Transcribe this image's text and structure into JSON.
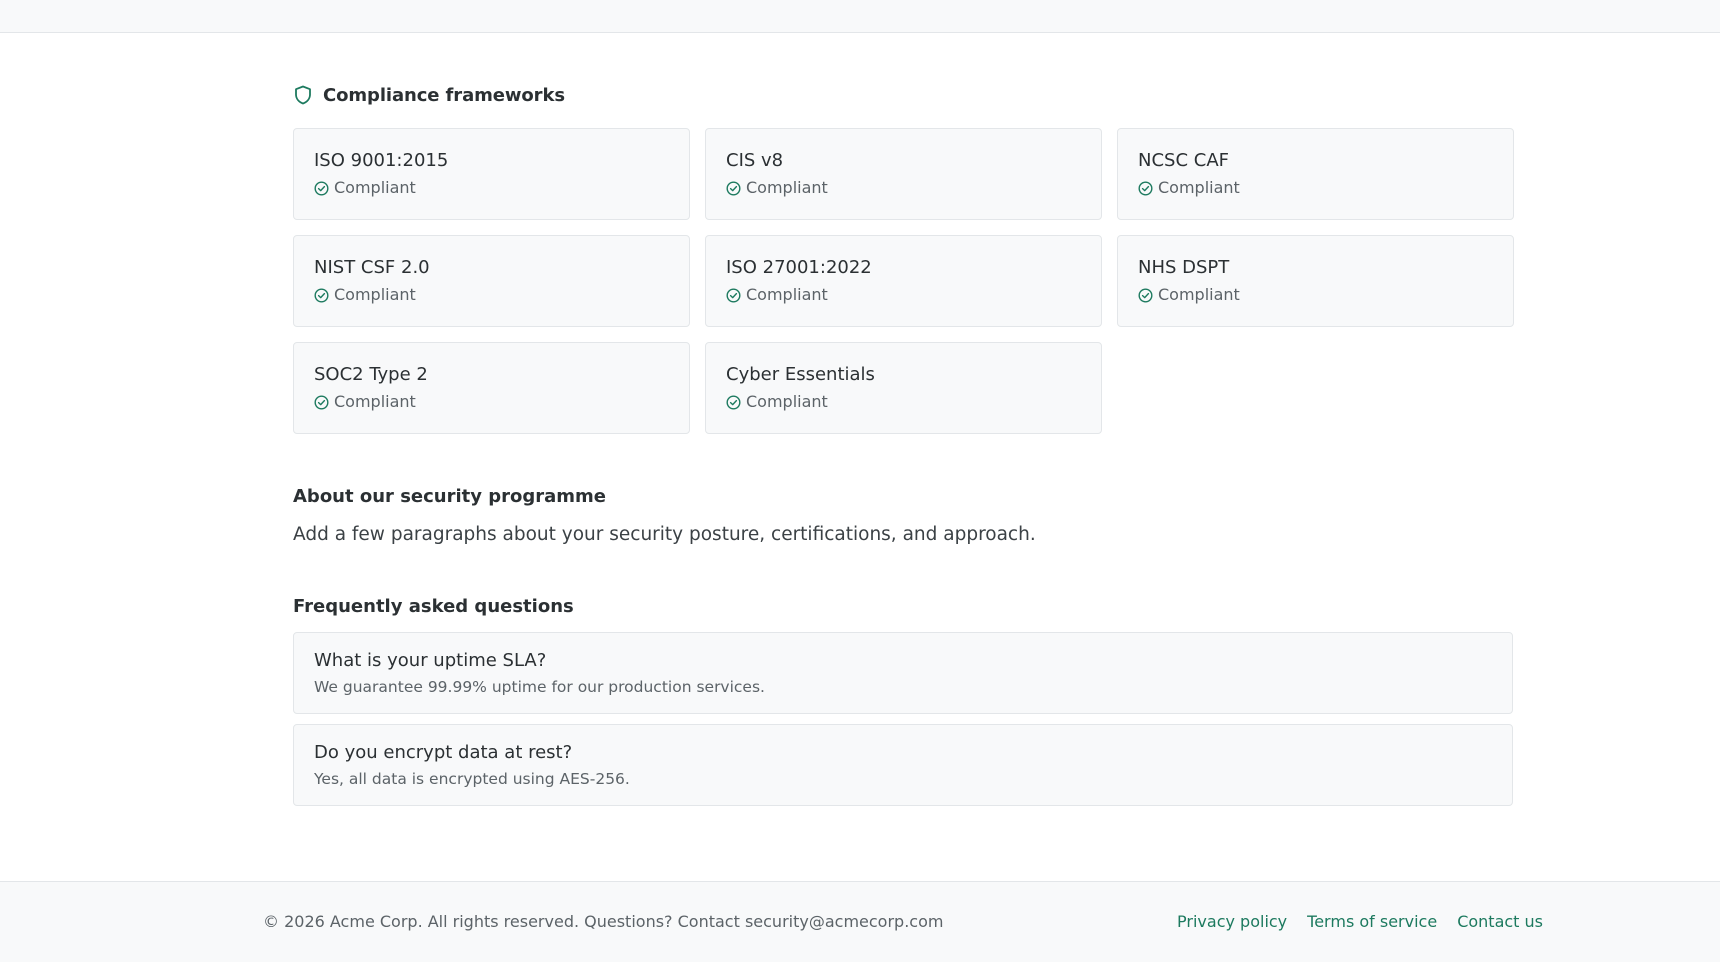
{
  "colors": {
    "accent": "#1d7a5f",
    "card_bg": "#f8f9fa",
    "border": "#e3e6e9"
  },
  "frameworks": {
    "icon": "shield-icon",
    "title": "Compliance frameworks",
    "items": [
      {
        "name": "ISO 9001:2015",
        "status": "Compliant"
      },
      {
        "name": "CIS v8",
        "status": "Compliant"
      },
      {
        "name": "NCSC CAF",
        "status": "Compliant"
      },
      {
        "name": "NIST CSF 2.0",
        "status": "Compliant"
      },
      {
        "name": "ISO 27001:2022",
        "status": "Compliant"
      },
      {
        "name": "NHS DSPT",
        "status": "Compliant"
      },
      {
        "name": "SOC2 Type 2",
        "status": "Compliant"
      },
      {
        "name": "Cyber Essentials",
        "status": "Compliant"
      }
    ]
  },
  "about": {
    "title": "About our security programme",
    "text": "Add a few paragraphs about your security posture, certifications, and approach."
  },
  "faq": {
    "title": "Frequently asked questions",
    "items": [
      {
        "question": "What is your uptime SLA?",
        "answer": "We guarantee 99.99% uptime for our production services."
      },
      {
        "question": "Do you encrypt data at rest?",
        "answer": "Yes, all data is encrypted using AES-256."
      }
    ]
  },
  "footer": {
    "text": "© 2026 Acme Corp. All rights reserved. Questions? Contact security@acmecorp.com",
    "links": [
      "Privacy policy",
      "Terms of service",
      "Contact us"
    ]
  }
}
